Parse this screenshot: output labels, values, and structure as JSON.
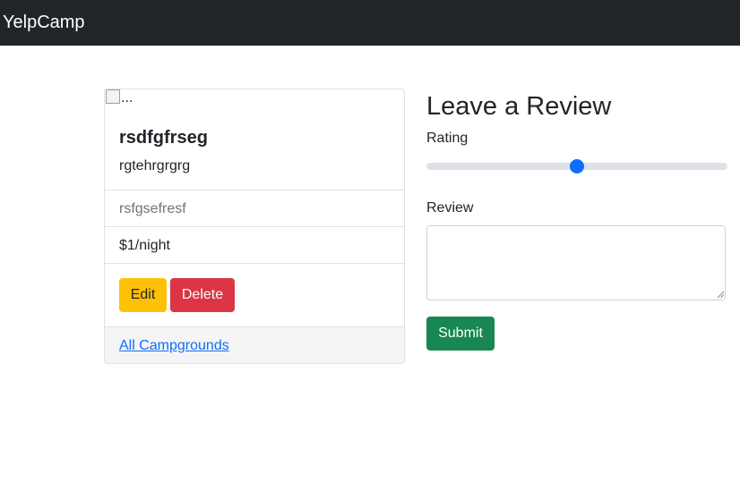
{
  "navbar": {
    "brand": "YelpCamp"
  },
  "campground": {
    "image_alt": "...",
    "title": "rsdfgfrseg",
    "description": "rgtehrgrgrg",
    "location": "rsfgsefresf",
    "price": "$1/night",
    "edit_label": "Edit",
    "delete_label": "Delete",
    "all_link": "All Campgrounds"
  },
  "review_form": {
    "heading": "Leave a Review",
    "rating_label": "Rating",
    "rating_value": 3,
    "rating_min": 1,
    "rating_max": 5,
    "review_label": "Review",
    "review_value": "",
    "submit_label": "Submit"
  },
  "colors": {
    "navbar": "#212529",
    "edit": "#ffc107",
    "delete": "#dc3545",
    "submit": "#198754",
    "link": "#0d6efd",
    "slider_thumb": "#0d6efd"
  }
}
